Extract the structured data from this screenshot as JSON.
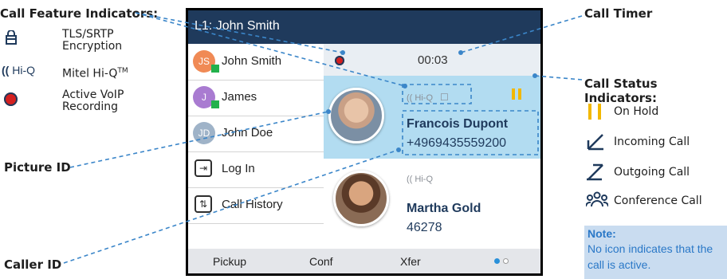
{
  "annotations": {
    "call_feature_indicators": "Call Feature Indicators:",
    "call_timer": "Call Timer",
    "call_status_indicators": "Call Status Indicators:",
    "picture_id": "Picture ID",
    "caller_id": "Caller ID"
  },
  "feature_legend": [
    {
      "icon": "lock-icon",
      "label_line1": "TLS/SRTP",
      "label_line2": "Encryption"
    },
    {
      "icon": "hiq-icon",
      "icon_text": "Hi-Q",
      "label_line1": "Mitel Hi-Q",
      "label_sup": "TM"
    },
    {
      "icon": "recording-icon",
      "label_line1": "Active VoIP",
      "label_line2": "Recording"
    }
  ],
  "status_legend": [
    {
      "icon": "hold-icon",
      "label": "On Hold"
    },
    {
      "icon": "incoming-call-icon",
      "label": "Incoming Call"
    },
    {
      "icon": "outgoing-call-icon",
      "label": "Outgoing Call"
    },
    {
      "icon": "conference-call-icon",
      "label": "Conference Call"
    }
  ],
  "note": {
    "title": "Note:",
    "text": "No icon indicates that the call is active."
  },
  "phone": {
    "title": "L1: John Smith",
    "timer": "00:03",
    "contacts": [
      {
        "initials": "JS",
        "name": "John Smith",
        "color": "#f08a55",
        "presence": true
      },
      {
        "initials": "J",
        "name": "James",
        "color": "#a97bd1",
        "presence": true
      },
      {
        "initials": "JD",
        "name": "John Doe",
        "color": "#9fb3c8",
        "presence": false
      }
    ],
    "actions": [
      {
        "icon": "login-icon",
        "label": "Log In"
      },
      {
        "icon": "call-history-icon",
        "label": "Call History"
      }
    ],
    "calls": [
      {
        "hiq": "Hi-Q",
        "name": "Francois Dupont",
        "number": "+4969435559200",
        "status": "hold"
      },
      {
        "hiq": "Hi-Q",
        "name": "Martha Gold",
        "number": "46278",
        "status": "active"
      }
    ],
    "softkeys": [
      "Pickup",
      "Conf",
      "Xfer"
    ]
  },
  "colors": {
    "title_bar": "#1f3a5c",
    "hold": "#f2b800",
    "recording": "#d42020",
    "annotation_line": "#3b86c9",
    "note_bg": "#c9dcf0",
    "note_text": "#2a78c7",
    "active_call_bg": "#b2dcf1"
  }
}
